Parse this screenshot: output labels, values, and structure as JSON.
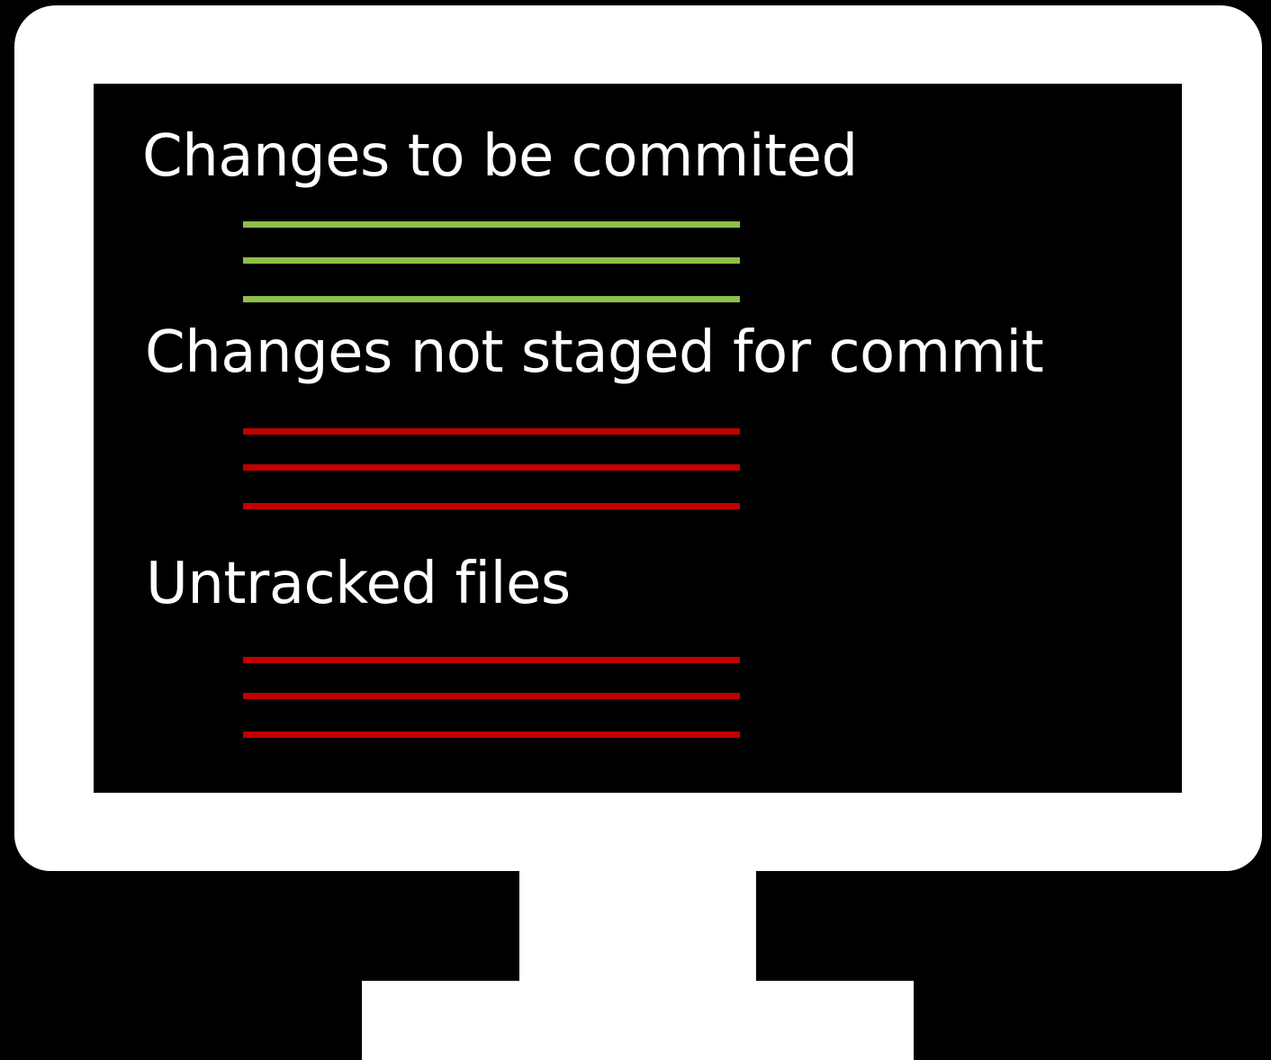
{
  "sections": [
    {
      "label": "Changes to be commited",
      "line_color": "#8fbe4b",
      "line_count": 3
    },
    {
      "label": "Changes not staged for commit",
      "line_color": "#c00000",
      "line_count": 3
    },
    {
      "label": "Untracked files",
      "line_color": "#c00000",
      "line_count": 3
    }
  ],
  "colors": {
    "background": "#000000",
    "monitor": "#ffffff",
    "text": "#ffffff",
    "staged": "#8fbe4b",
    "unstaged": "#c00000"
  }
}
